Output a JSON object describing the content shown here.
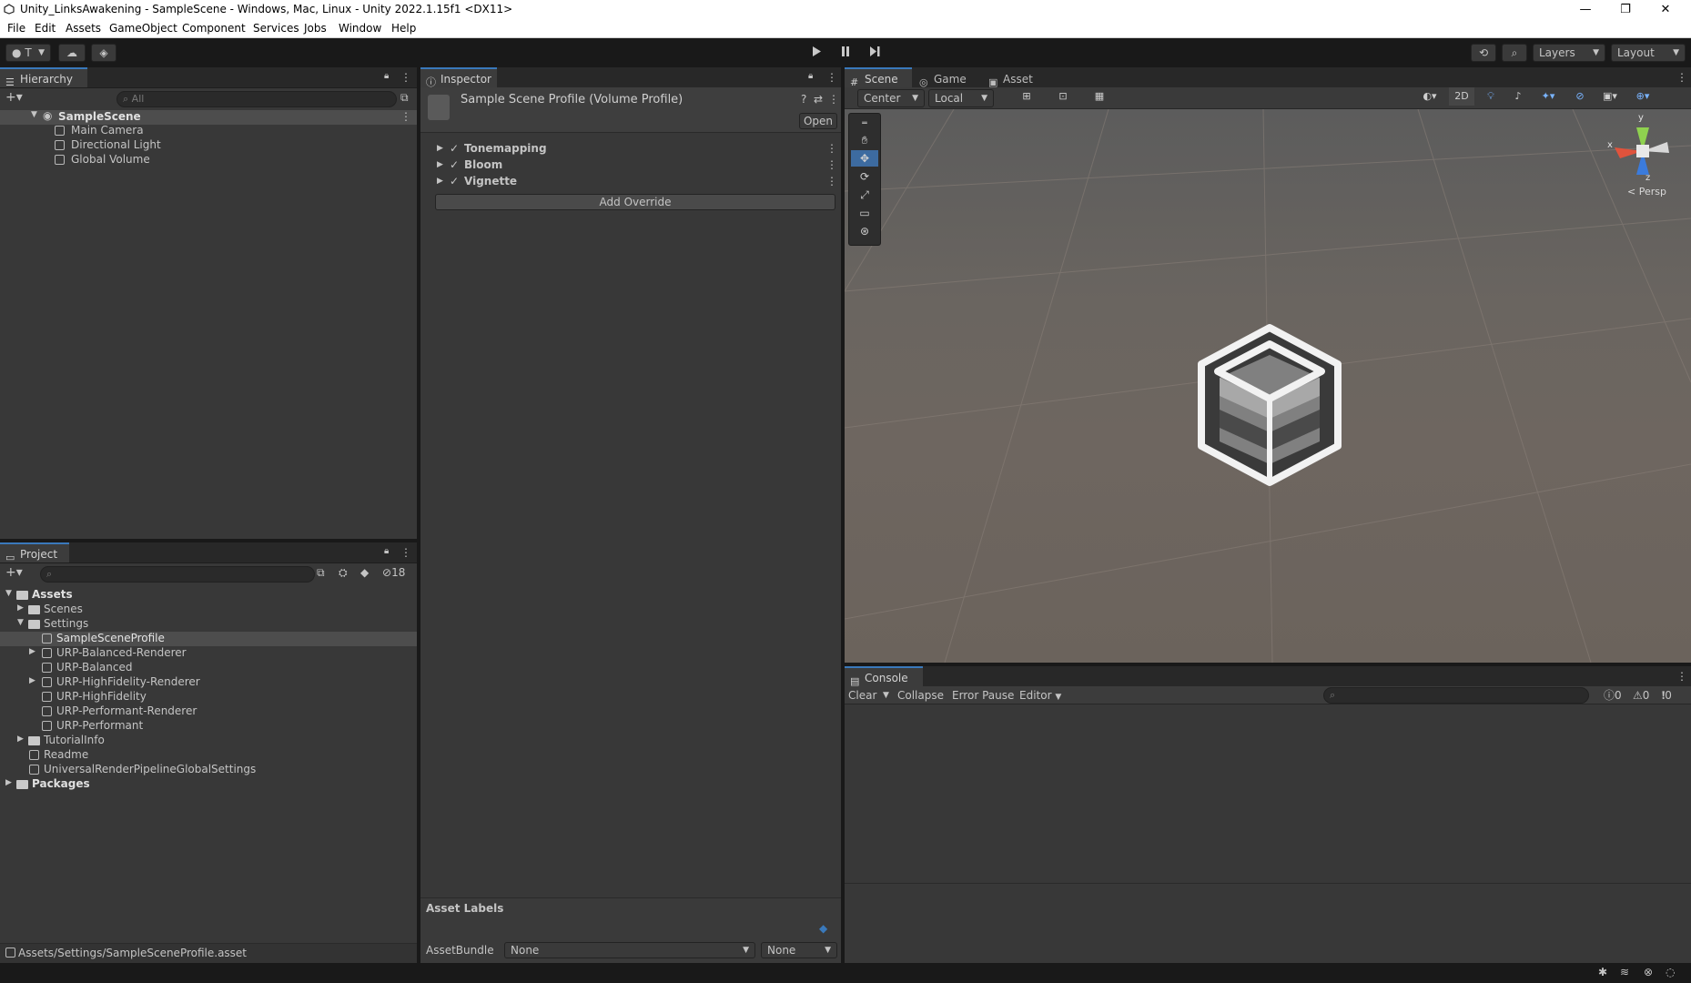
{
  "window": {
    "title": "Unity_LinksAwakening - SampleScene - Windows, Mac, Linux - Unity 2022.1.15f1 <DX11>",
    "minimize": "—",
    "restore": "❐",
    "close": "✕"
  },
  "menu": [
    "File",
    "Edit",
    "Assets",
    "GameObject",
    "Component",
    "Services",
    "Jobs",
    "Window",
    "Help"
  ],
  "toolbar": {
    "account_label": "T",
    "layers_label": "Layers",
    "layout_label": "Layout"
  },
  "hierarchy": {
    "tab_label": "Hierarchy",
    "search_placeholder": "All",
    "scene_name": "SampleScene",
    "items": [
      "Main Camera",
      "Directional Light",
      "Global Volume"
    ]
  },
  "project": {
    "tab_label": "Project",
    "hidden_count": "18",
    "tree": {
      "assets": "Assets",
      "scenes": "Scenes",
      "settings": "Settings",
      "settings_items": [
        "SampleSceneProfile",
        "URP-Balanced-Renderer",
        "URP-Balanced",
        "URP-HighFidelity-Renderer",
        "URP-HighFidelity",
        "URP-Performant-Renderer",
        "URP-Performant"
      ],
      "tutorial_info": "TutorialInfo",
      "readme": "Readme",
      "urp_global": "UniversalRenderPipelineGlobalSettings",
      "packages": "Packages"
    },
    "status_path": "Assets/Settings/SampleSceneProfile.asset"
  },
  "inspector": {
    "tab_label": "Inspector",
    "asset_title": "Sample Scene Profile (Volume Profile)",
    "open_button": "Open",
    "overrides": [
      "Tonemapping",
      "Bloom",
      "Vignette"
    ],
    "add_override": "Add Override",
    "asset_labels": "Asset Labels",
    "assetbundle_label": "AssetBundle",
    "assetbundle_value": "None",
    "assetbundle_variant": "None"
  },
  "scene": {
    "tabs": [
      "Scene",
      "Game",
      "Asset Store"
    ],
    "pivot": "Center",
    "space": "Local",
    "mode_2d": "2D",
    "persp": "< Persp",
    "axis_x": "x",
    "axis_y": "y",
    "axis_z": "z"
  },
  "console": {
    "tab_label": "Console",
    "clear": "Clear",
    "collapse": "Collapse",
    "error_pause": "Error Pause",
    "editor": "Editor",
    "log_count": "0",
    "warn_count": "0",
    "error_count": "0"
  },
  "colors": {
    "accent": "#3a79bb",
    "panel": "#383838",
    "tabbar": "#282828",
    "selection": "#4d4d4d"
  }
}
